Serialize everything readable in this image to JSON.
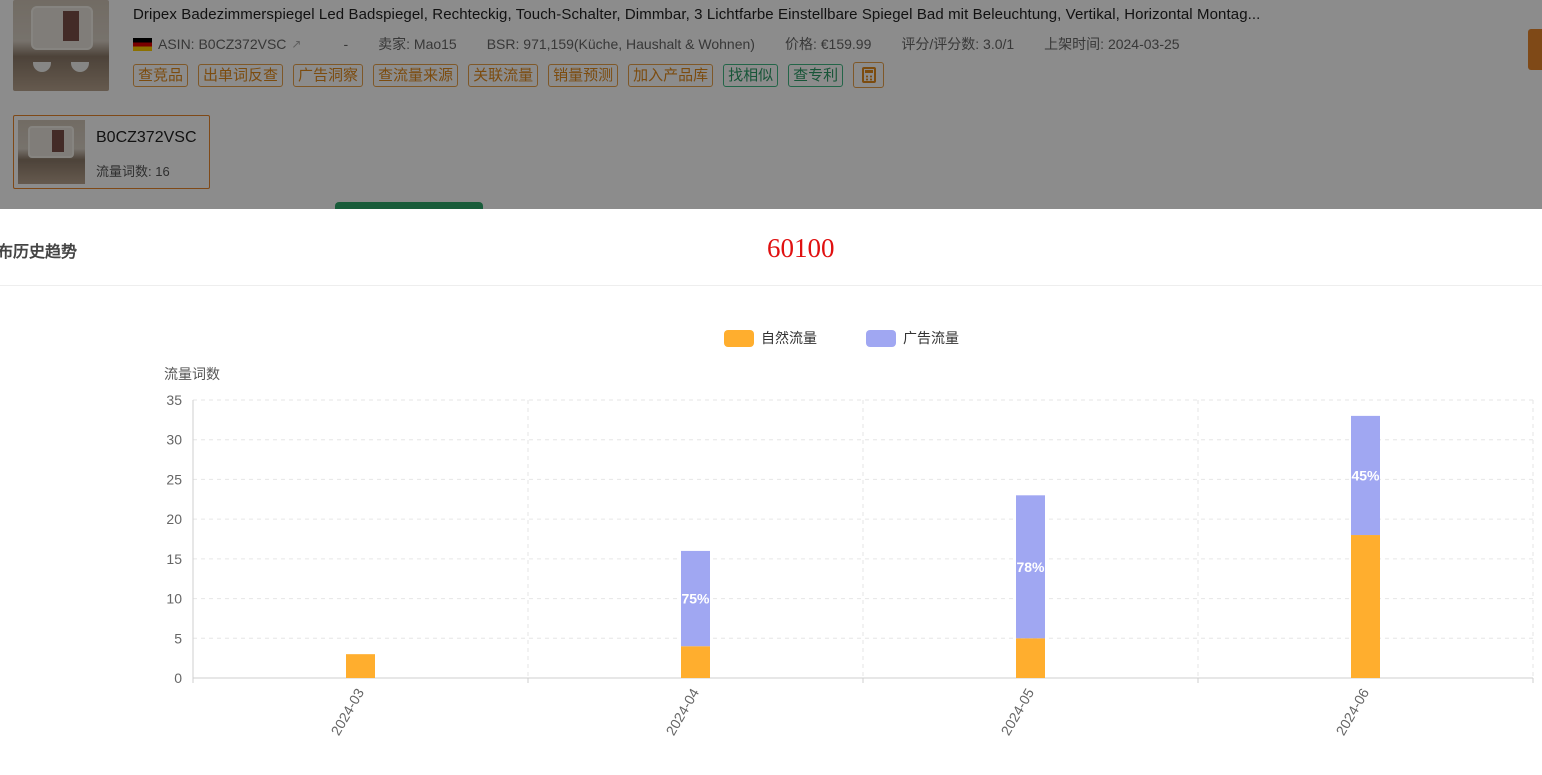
{
  "product": {
    "title": "Dripex Badezimmerspiegel Led Badspiegel, Rechteckig, Touch-Schalter, Dimmbar, 3 Lichtfarbe Einstellbare Spiegel Bad mit Beleuchtung, Vertikal, Horizontal Montag...",
    "asin_label": "ASIN: B0CZ372VSC",
    "dash": "-",
    "seller": "卖家: Mao15",
    "bsr": "BSR: 971,159(Küche, Haushalt & Wohnen)",
    "price": "价格: €159.99",
    "rating": "评分/评分数: 3.0/1",
    "listed": "上架时间: 2024-03-25",
    "country_flag_icon": "germany-flag-icon"
  },
  "actions": [
    {
      "label": "查竞品",
      "style": "orange"
    },
    {
      "label": "出单词反查",
      "style": "orange"
    },
    {
      "label": "广告洞察",
      "style": "orange"
    },
    {
      "label": "查流量来源",
      "style": "orange"
    },
    {
      "label": "关联流量",
      "style": "orange"
    },
    {
      "label": "销量预测",
      "style": "orange"
    },
    {
      "label": "加入产品库",
      "style": "orange"
    },
    {
      "label": "找相似",
      "style": "green"
    },
    {
      "label": "查专利",
      "style": "green"
    }
  ],
  "asin_card": {
    "asin": "B0CZ372VSC",
    "count_label": "流量词数: 16"
  },
  "modal": {
    "title": "布历史趋势",
    "watermark": "60100"
  },
  "colors": {
    "natural": "#ffae2e",
    "ads": "#a0a7f2",
    "accent": "#e8862a",
    "watermark": "#e01010"
  },
  "chart_data": {
    "type": "bar",
    "stacked": true,
    "categories": [
      "2024-03",
      "2024-04",
      "2024-05",
      "2024-06"
    ],
    "series": [
      {
        "name": "自然流量",
        "values": [
          3,
          4,
          5,
          18
        ]
      },
      {
        "name": "广告流量",
        "values": [
          0,
          12,
          18,
          15
        ]
      }
    ],
    "data_labels": [
      "",
      "75%",
      "78%",
      "45%"
    ],
    "ylabel": "流量词数",
    "ylim": [
      0,
      35
    ],
    "yticks": [
      0,
      5,
      10,
      15,
      20,
      25,
      30,
      35
    ],
    "grid": true,
    "legend_position": "top-center"
  }
}
